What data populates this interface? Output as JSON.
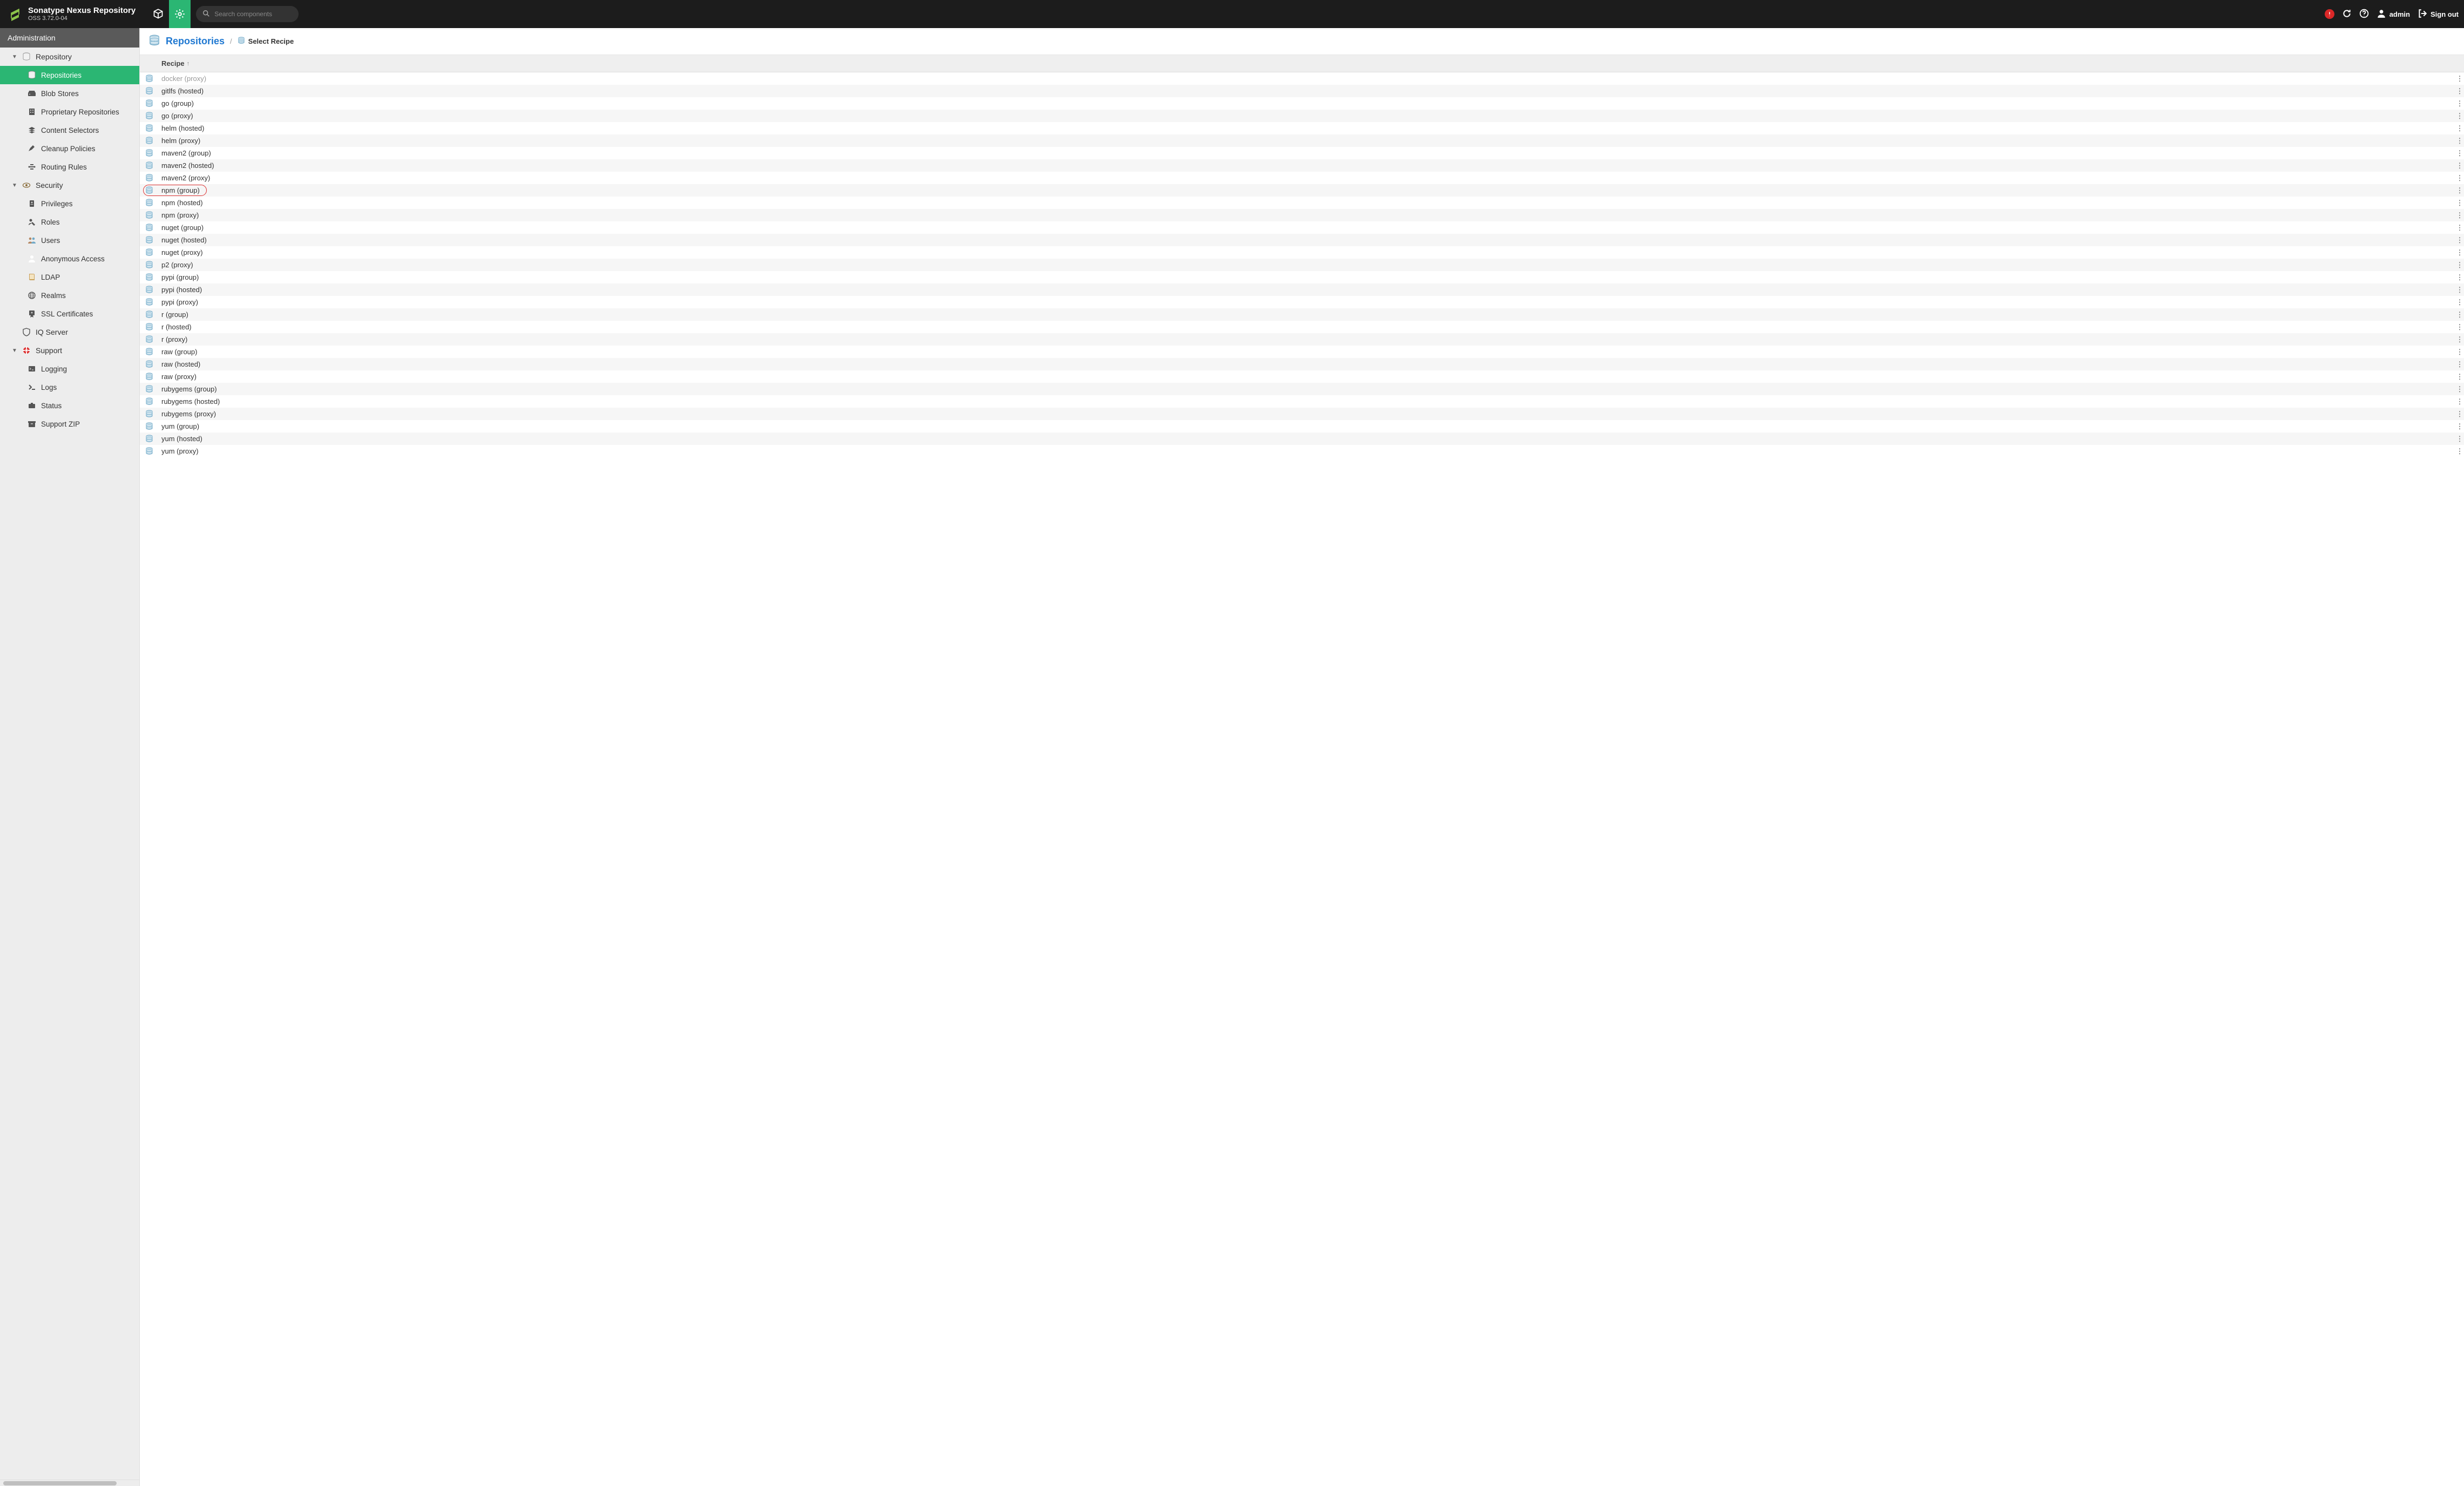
{
  "header": {
    "product_title": "Sonatype Nexus Repository",
    "product_version": "OSS 3.72.0-04",
    "search_placeholder": "Search components",
    "user_label": "admin",
    "signout_label": "Sign out"
  },
  "sidebar": {
    "title": "Administration",
    "groups": [
      {
        "label": "Repository",
        "icon": "database",
        "expanded": true,
        "children": [
          {
            "label": "Repositories",
            "icon": "database",
            "active": true
          },
          {
            "label": "Blob Stores",
            "icon": "hdd"
          },
          {
            "label": "Proprietary Repositories",
            "icon": "building"
          },
          {
            "label": "Content Selectors",
            "icon": "layers"
          },
          {
            "label": "Cleanup Policies",
            "icon": "broom"
          },
          {
            "label": "Routing Rules",
            "icon": "route"
          }
        ]
      },
      {
        "label": "Security",
        "icon": "eye",
        "expanded": true,
        "children": [
          {
            "label": "Privileges",
            "icon": "id-badge"
          },
          {
            "label": "Roles",
            "icon": "user-tag"
          },
          {
            "label": "Users",
            "icon": "users"
          },
          {
            "label": "Anonymous Access",
            "icon": "user"
          },
          {
            "label": "LDAP",
            "icon": "book"
          },
          {
            "label": "Realms",
            "icon": "globe"
          },
          {
            "label": "SSL Certificates",
            "icon": "certificate"
          }
        ]
      },
      {
        "label": "IQ Server",
        "icon": "shield",
        "expanded": false,
        "children": []
      },
      {
        "label": "Support",
        "icon": "lifebuoy",
        "expanded": true,
        "children": [
          {
            "label": "Logging",
            "icon": "terminal"
          },
          {
            "label": "Logs",
            "icon": "prompt"
          },
          {
            "label": "Status",
            "icon": "briefcase"
          },
          {
            "label": "Support ZIP",
            "icon": "archive"
          }
        ]
      }
    ]
  },
  "breadcrumb": {
    "main": "Repositories",
    "sub": "Select Recipe"
  },
  "grid": {
    "column_label": "Recipe",
    "sort_dir": "asc",
    "highlighted_name": "npm (group)",
    "rows": [
      {
        "name": "docker (proxy)",
        "faded": true
      },
      {
        "name": "gitlfs (hosted)"
      },
      {
        "name": "go (group)"
      },
      {
        "name": "go (proxy)"
      },
      {
        "name": "helm (hosted)"
      },
      {
        "name": "helm (proxy)"
      },
      {
        "name": "maven2 (group)"
      },
      {
        "name": "maven2 (hosted)"
      },
      {
        "name": "maven2 (proxy)"
      },
      {
        "name": "npm (group)"
      },
      {
        "name": "npm (hosted)"
      },
      {
        "name": "npm (proxy)"
      },
      {
        "name": "nuget (group)"
      },
      {
        "name": "nuget (hosted)"
      },
      {
        "name": "nuget (proxy)"
      },
      {
        "name": "p2 (proxy)"
      },
      {
        "name": "pypi (group)"
      },
      {
        "name": "pypi (hosted)"
      },
      {
        "name": "pypi (proxy)"
      },
      {
        "name": "r (group)"
      },
      {
        "name": "r (hosted)"
      },
      {
        "name": "r (proxy)"
      },
      {
        "name": "raw (group)"
      },
      {
        "name": "raw (hosted)"
      },
      {
        "name": "raw (proxy)"
      },
      {
        "name": "rubygems (group)"
      },
      {
        "name": "rubygems (hosted)"
      },
      {
        "name": "rubygems (proxy)"
      },
      {
        "name": "yum (group)"
      },
      {
        "name": "yum (hosted)"
      },
      {
        "name": "yum (proxy)"
      }
    ]
  }
}
